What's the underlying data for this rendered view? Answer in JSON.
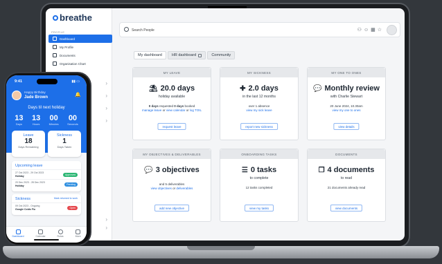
{
  "laptop": {
    "brand": "breathe",
    "sidebar": {
      "section": "PROFILE",
      "items": [
        {
          "label": "Dashboard"
        },
        {
          "label": "My Profile"
        },
        {
          "label": "Documents"
        },
        {
          "label": "Organisation Chart"
        }
      ]
    },
    "search": {
      "placeholder": "Search People"
    },
    "tabs": [
      {
        "label": "My dashboard"
      },
      {
        "label": "HR dashboard"
      },
      {
        "label": "Community"
      }
    ],
    "cards": {
      "my_leave": {
        "header": "MY LEAVE",
        "big": "20.0 days",
        "sub": "holiday available",
        "line1_a": "0 days",
        "line1_b": " requested ",
        "line1_c": "0 days",
        "line1_d": " booked",
        "link1": "manage leave",
        "or1": " or ",
        "link2": "view calendar",
        "or2": " or ",
        "link3": "log TOIL",
        "button": "request leave"
      },
      "my_sickness": {
        "header": "MY SICKNESS",
        "big": "2.0 days",
        "sub": "in the last 12 months",
        "line1": "over 1 absence",
        "link1": "view my sick leave",
        "button": "report new sickness"
      },
      "my_one_to_ones": {
        "header": "MY ONE TO ONES",
        "big": "Monthly review",
        "sub": "with Charlie Stewart",
        "line1": "20 June 2024, 10.30am",
        "link1": "view my one to ones",
        "button": "view details"
      },
      "objectives": {
        "header": "MY OBJECTIVES & DELIVERABLES",
        "big": "3 objectives",
        "line1": "and 5 deliverables",
        "link1": "view objectives",
        "or1": " or ",
        "link2": "deliverables",
        "button": "add new objective"
      },
      "onboarding": {
        "header": "ONBOARDING TASKS",
        "big": "0 tasks",
        "sub": "to complete",
        "line1": "12 tasks completed",
        "button": "view my tasks"
      },
      "documents": {
        "header": "DOCUMENTS",
        "big": "4 documents",
        "sub": "to read",
        "line1": "21 documents already read",
        "button": "view documents"
      }
    }
  },
  "phone": {
    "time": "9:41",
    "greeting": "Happy Birthday",
    "name": "Jade Brown",
    "days_to_holiday": "Days til next holiday",
    "countdown": [
      {
        "num": "13",
        "label": "Days"
      },
      {
        "num": "13",
        "label": "Hours"
      },
      {
        "num": "00",
        "label": "Minutes"
      },
      {
        "num": "00",
        "label": "Seconds"
      }
    ],
    "leave": {
      "title": "Leave",
      "num": "18",
      "sub": "Days Remaining"
    },
    "sickness": {
      "title": "Sickness",
      "num": "1",
      "sub": "Days Taken"
    },
    "upcoming": {
      "title": "Upcoming leave",
      "rows": [
        {
          "date": "27 Oct 2023 - 29 Oct 2023",
          "type": "Holiday",
          "status": "Approved"
        },
        {
          "date": "20 Dec 2023 - 28 Dec 2023",
          "type": "Holiday",
          "status": "Pending"
        }
      ]
    },
    "sick": {
      "title": "Sickness",
      "link": "Mark returned to work",
      "row": {
        "date": "09 Oct 2023 - Ongoing",
        "type": "Google Colds Flu",
        "status": "Open"
      }
    },
    "nav": [
      {
        "label": "Dashboard"
      },
      {
        "label": "Calendar"
      },
      {
        "label": "Rotas"
      },
      {
        "label": "More"
      }
    ]
  },
  "colors": {
    "accent": "#1d6fe8",
    "approved": "#2bb673",
    "pending": "#2f8fe0",
    "open": "#e5484d"
  }
}
